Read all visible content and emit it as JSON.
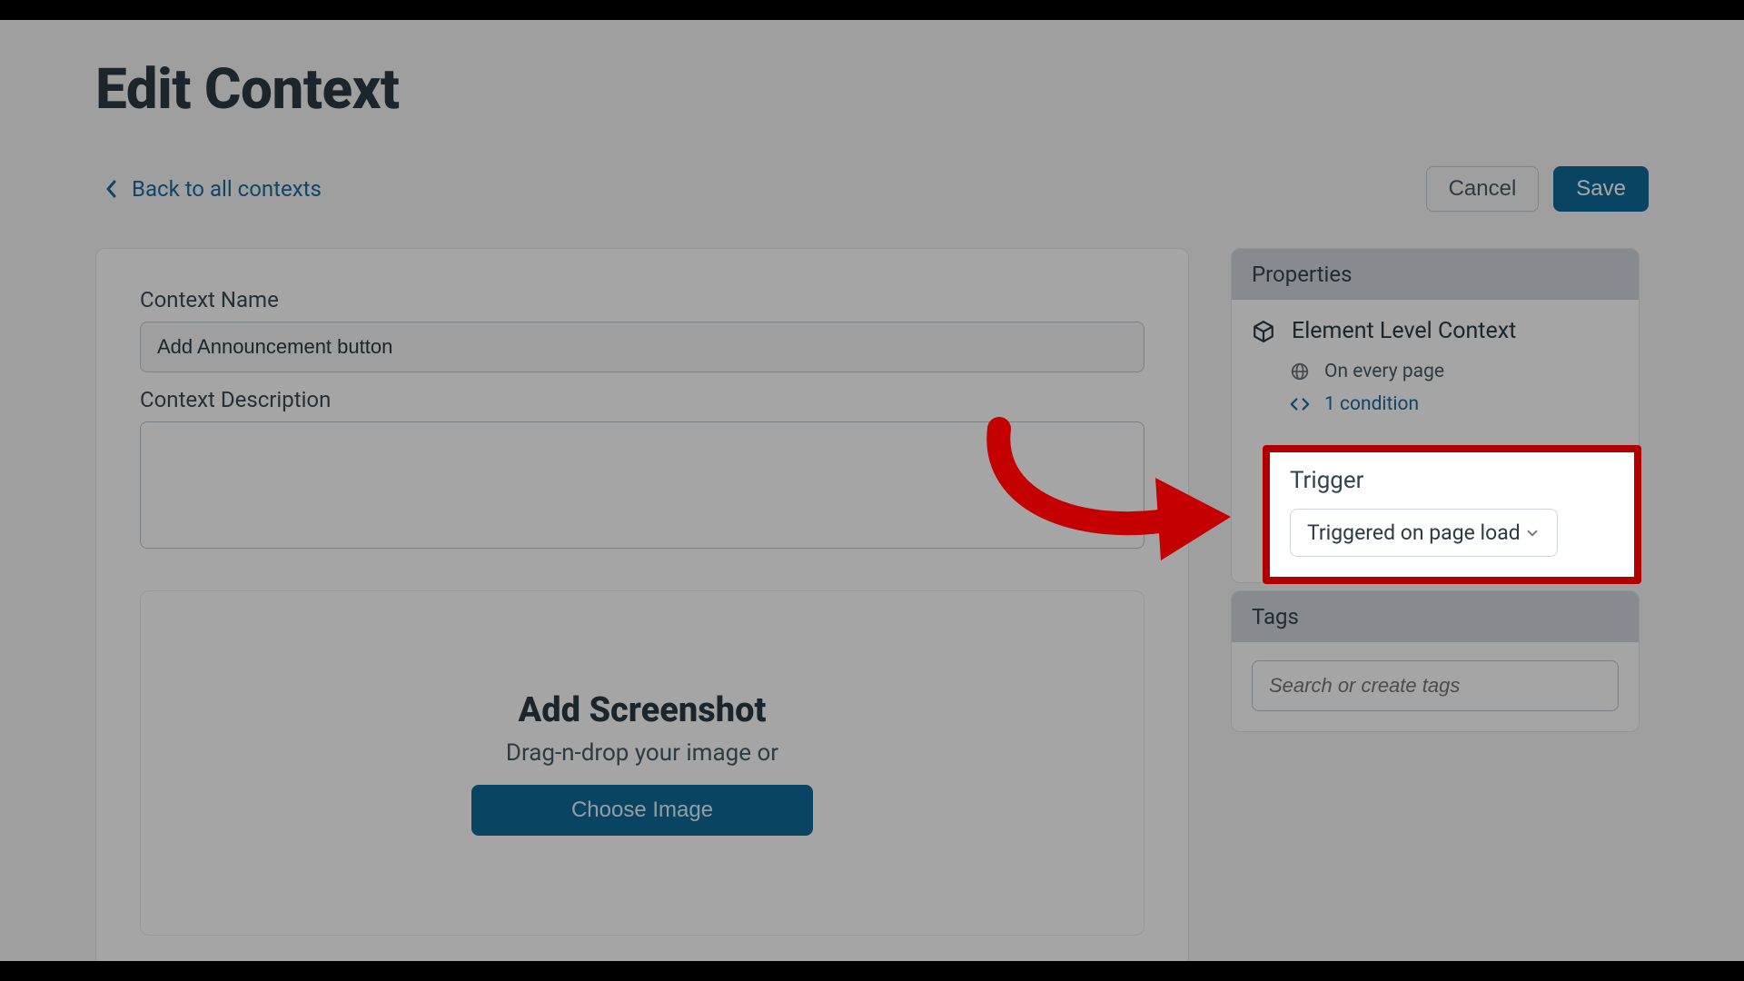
{
  "page_title": "Edit Context",
  "nav": {
    "back_label": "Back to all contexts"
  },
  "actions": {
    "cancel": "Cancel",
    "save": "Save"
  },
  "form": {
    "name_label": "Context Name",
    "name_value": "Add Announcement button",
    "desc_label": "Context Description",
    "desc_value": ""
  },
  "screenshot": {
    "title": "Add Screenshot",
    "subtitle": "Drag-n-drop your image or",
    "choose_label": "Choose Image"
  },
  "properties": {
    "header": "Properties",
    "context_type": "Element Level Context",
    "scope": "On every page",
    "conditions": "1 condition"
  },
  "trigger": {
    "label": "Trigger",
    "value": "Triggered on page load"
  },
  "tags": {
    "header": "Tags",
    "placeholder": "Search or create tags"
  }
}
